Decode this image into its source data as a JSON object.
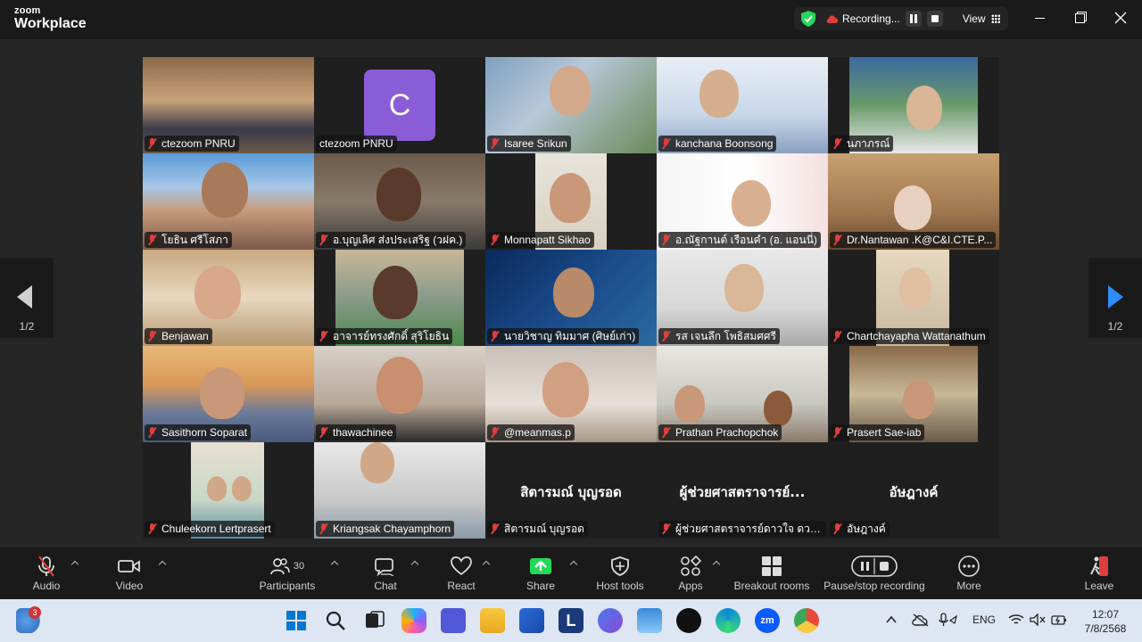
{
  "app": {
    "logo_top": "zoom",
    "logo_bottom": "Workplace"
  },
  "recording": {
    "label": "Recording...",
    "view_label": "View"
  },
  "nav": {
    "page_left": "1/2",
    "page_right": "1/2"
  },
  "tiles": [
    {
      "name": "ctezoom PNRU",
      "active": true
    },
    {
      "name": "ctezoom PNRU",
      "avatar_letter": "C"
    },
    {
      "name": "Isaree Srikun"
    },
    {
      "name": "kanchana Boonsong"
    },
    {
      "name": "นภาภรณ์"
    },
    {
      "name": "โยธิน ศรีโสภา"
    },
    {
      "name": "อ.บุญเลิศ ส่งประเสริฐ (วฝค.)"
    },
    {
      "name": "Monnapatt Sikhao"
    },
    {
      "name": "อ.ณัฐกานต์ เรือนคำ (อ. แอนนี่)"
    },
    {
      "name": "Dr.Nantawan .K@C&I.CTE.P..."
    },
    {
      "name": "Benjawan"
    },
    {
      "name": "อาจารย์ทรงศักดิ์ สุริโยธิน"
    },
    {
      "name": "นายวิชาญ ทิมมาศ (ศิษย์เก่า)"
    },
    {
      "name": "รส เจนลึก โพธิสมศศรี"
    },
    {
      "name": "Chartchayapha Wattanathum"
    },
    {
      "name": "Sasithorn Soparat"
    },
    {
      "name": "thawachinee"
    },
    {
      "name": "@meanmas.p"
    },
    {
      "name": "Prathan Prachopchok"
    },
    {
      "name": "Prasert Sae-iab"
    },
    {
      "name": "Chuleekorn Lertprasert"
    },
    {
      "name": "Kriangsak Chayamphorn"
    },
    {
      "name": "สิตารมณ์ บุญรอด",
      "big_name": "สิตารมณ์ บุญรอด"
    },
    {
      "name": "ผู้ช่วยศาสตราจารย์ดาวใจ ดวงมณี",
      "big_name": "ผู้ช่วยศาสตราจารย์..."
    },
    {
      "name": "อัษฎางค์",
      "big_name": "อัษฎางค์"
    }
  ],
  "toolbar": {
    "audio": "Audio",
    "video": "Video",
    "participants": "Participants",
    "participants_count": "30",
    "chat": "Chat",
    "react": "React",
    "share": "Share",
    "host_tools": "Host tools",
    "apps": "Apps",
    "breakout": "Breakout rooms",
    "pause_rec": "Pause/stop recording",
    "more": "More",
    "leave": "Leave"
  },
  "taskbar": {
    "notification_count": "3",
    "language": "ENG",
    "time": "12:07",
    "date": "7/8/2568"
  },
  "colors": {
    "accent": "#2d8cff",
    "active_border": "#23d959",
    "muted_mic": "#e03e3e",
    "leave": "#e03e3e",
    "share": "#23d959"
  }
}
